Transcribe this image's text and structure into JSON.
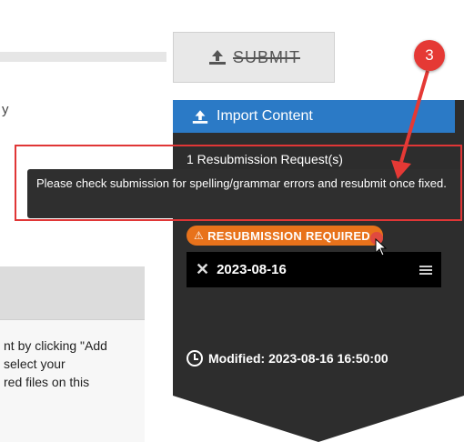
{
  "left": {
    "glyph": "y",
    "instructions": [
      "nt by clicking \"Add",
      "select your",
      "red files on this"
    ]
  },
  "submit": {
    "label": "SUBMIT",
    "icon": "upload-icon"
  },
  "sidebar": {
    "import_label": "Import Content",
    "resubmission_count": "1 Resubmission Request(s)",
    "badge_label": "RESUBMISSION REQUIRED",
    "date": "2023-08-16",
    "modified": "Modified: 2023-08-16 16:50:00"
  },
  "tooltip": {
    "text": "Please check submission for spelling/grammar errors and resubmit once fixed."
  },
  "annotation": {
    "step": "3"
  },
  "colors": {
    "accent_blue": "#2b7ac6",
    "badge_orange": "#e8721b",
    "annotation_red": "#e53935",
    "sidebar_dark": "#2d2d2d"
  }
}
